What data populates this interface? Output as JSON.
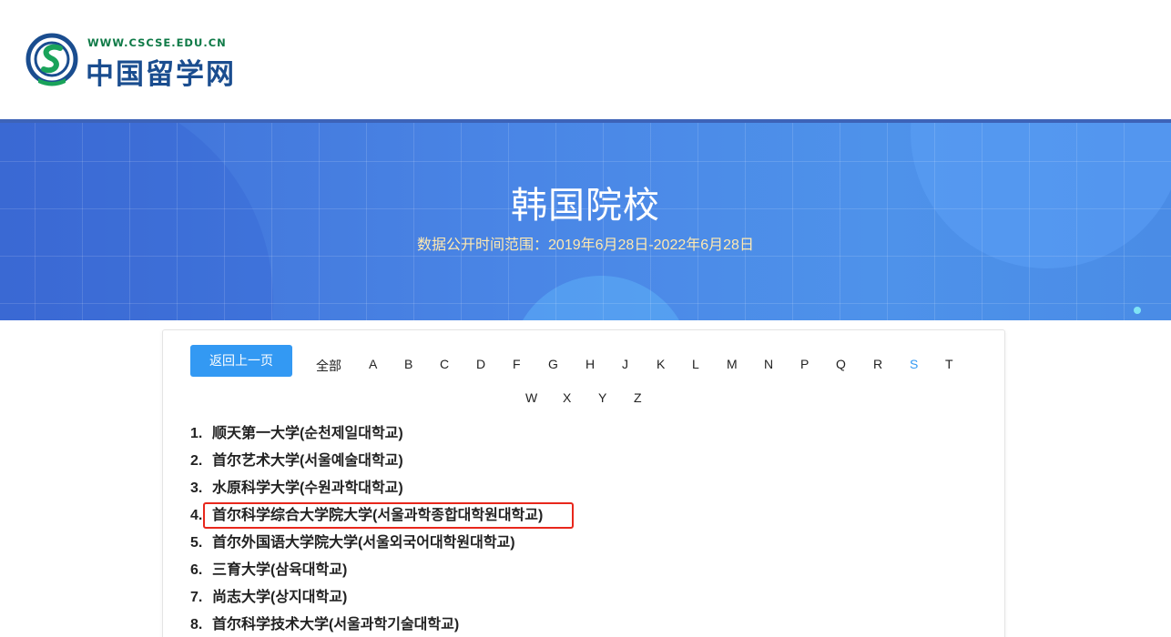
{
  "header": {
    "logo_url_text": "WWW.CSCSE.EDU.CN",
    "logo_name": "中国留学网"
  },
  "banner": {
    "title": "韩国院校",
    "subtitle": "数据公开时间范围：2019年6月28日-2022年6月28日"
  },
  "nav": {
    "back_label": "返回上一页",
    "letters_row1": [
      "全部",
      "A",
      "B",
      "C",
      "D",
      "F",
      "G",
      "H",
      "J",
      "K",
      "L",
      "M",
      "N",
      "P",
      "Q",
      "R",
      "S",
      "T"
    ],
    "letters_row2": [
      "W",
      "X",
      "Y",
      "Z"
    ],
    "active_letter": "S"
  },
  "schools": [
    {
      "num": "1.",
      "cn": "顺天第一大学",
      "kr": "(순천제일대학교)"
    },
    {
      "num": "2.",
      "cn": "首尔艺术大学",
      "kr": "(서울예술대학교)"
    },
    {
      "num": "3.",
      "cn": "水原科学大学",
      "kr": "(수원과학대학교)"
    },
    {
      "num": "4.",
      "cn": "首尔科学综合大学院大学",
      "kr": "(서울과학종합대학원대학교)"
    },
    {
      "num": "5.",
      "cn": "首尔外国语大学院大学",
      "kr": "(서울외국어대학원대학교)"
    },
    {
      "num": "6.",
      "cn": "三育大学",
      "kr": "(삼육대학교)"
    },
    {
      "num": "7.",
      "cn": "尚志大学",
      "kr": "(상지대학교)"
    },
    {
      "num": "8.",
      "cn": "首尔科学技术大学",
      "kr": "(서울과학기술대학교)"
    }
  ],
  "colors": {
    "accent": "#3399f3",
    "highlight": "#e8271c",
    "banner": "#4a86e6"
  }
}
